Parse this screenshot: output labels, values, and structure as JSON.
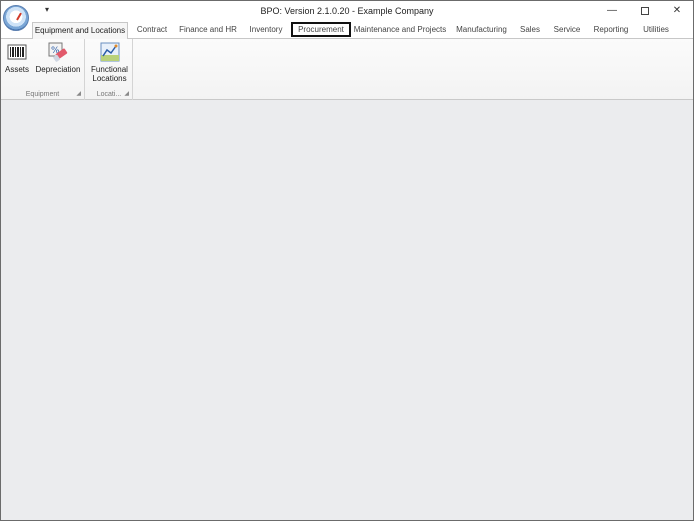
{
  "window": {
    "title": "BPO: Version 2.1.0.20 - Example Company"
  },
  "title_controls": {
    "qat_arrow": "▾",
    "minimize": "—",
    "close": "✕"
  },
  "tabs": [
    {
      "label": "Equipment and Locations",
      "active": true
    },
    {
      "label": "Contract"
    },
    {
      "label": "Finance and HR"
    },
    {
      "label": "Inventory"
    },
    {
      "label": "Procurement",
      "focused": true
    },
    {
      "label": "Maintenance and Projects"
    },
    {
      "label": "Manufacturing"
    },
    {
      "label": "Sales"
    },
    {
      "label": "Service"
    },
    {
      "label": "Reporting"
    },
    {
      "label": "Utilities"
    }
  ],
  "ribbon": {
    "groups": [
      {
        "caption": "Equipment",
        "buttons": [
          {
            "label": "Assets",
            "icon": "barcode-icon"
          },
          {
            "label": "Depreciation",
            "icon": "depreciation-icon"
          }
        ]
      },
      {
        "caption": "Locati...",
        "buttons": [
          {
            "label_line1": "Functional",
            "label_line2": "Locations",
            "icon": "chart-icon"
          }
        ]
      }
    ],
    "launcher_glyph": "◢"
  },
  "colors": {
    "workspace": "#ebecee",
    "accent_blue": "#3d6fae"
  }
}
